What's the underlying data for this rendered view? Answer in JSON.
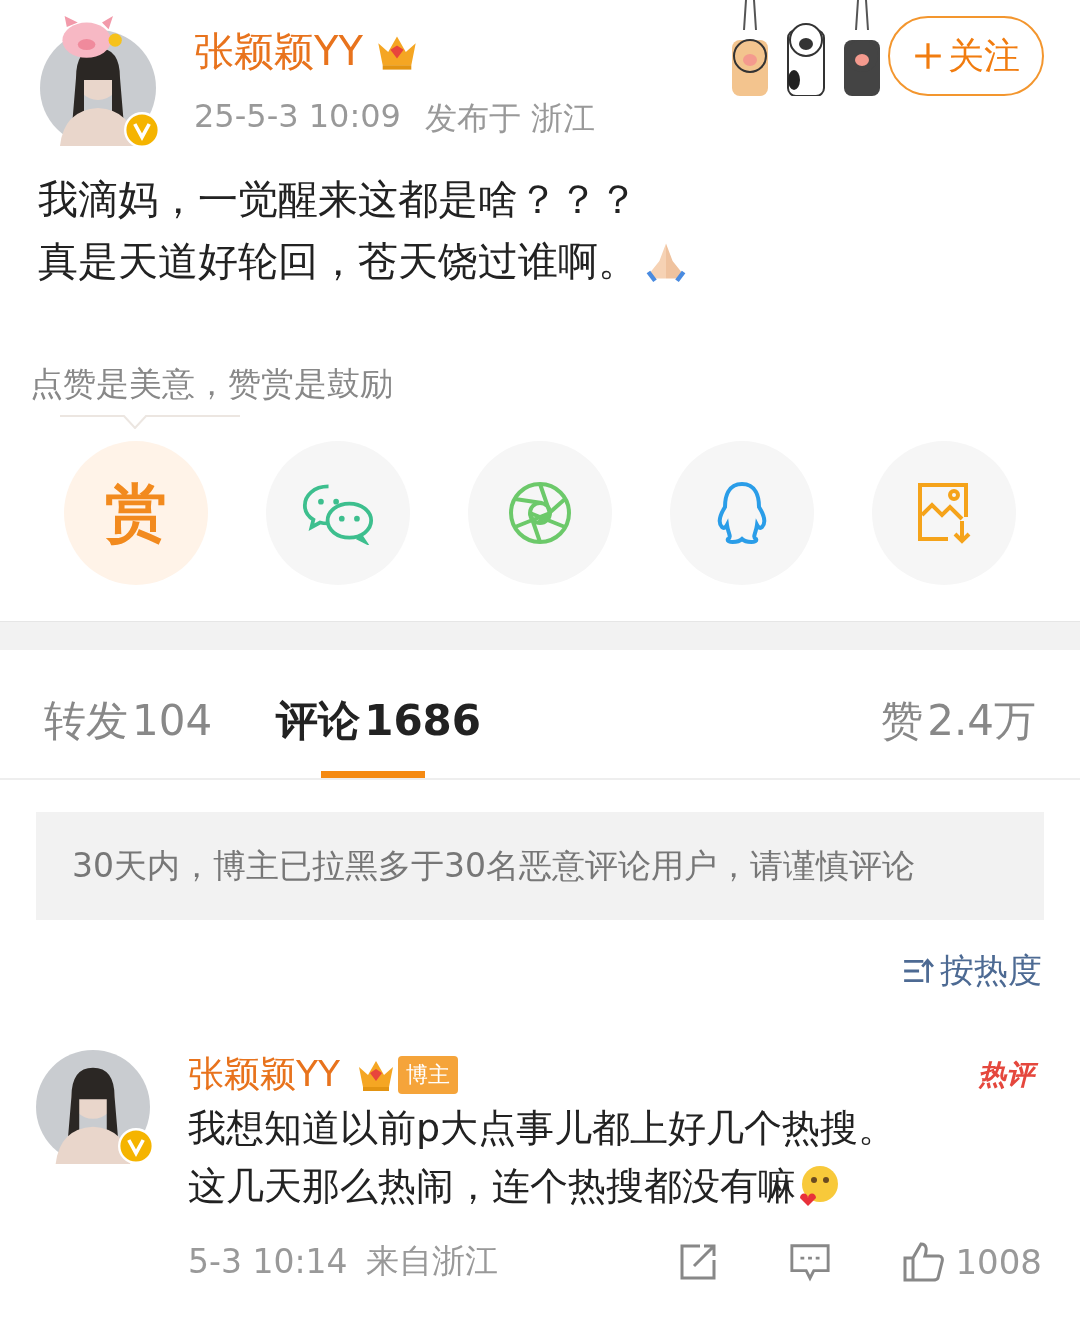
{
  "post": {
    "author": "张颖颖YY",
    "verified": true,
    "time": "25-5-3 10:09",
    "location": "发布于 浙江",
    "follow_button": "关注",
    "lines": [
      "我滴妈，一觉醒来这都是啥？？？",
      "真是天道好轮回，苍天饶过谁啊。"
    ]
  },
  "reward_hint": "点赞是美意，赞赏是鼓励",
  "share_actions": [
    {
      "kind": "reward",
      "label": "赏"
    },
    {
      "kind": "wechat"
    },
    {
      "kind": "moments"
    },
    {
      "kind": "qq"
    },
    {
      "kind": "save_image"
    }
  ],
  "tabs": [
    {
      "label": "转发",
      "count": "104",
      "selected": false
    },
    {
      "label": "评论",
      "count": "1686",
      "selected": true
    },
    {
      "label": "赞",
      "count": "2.4万",
      "selected": false
    }
  ],
  "notice": "30天内，博主已拉黑多于30名恶意评论用户，请谨慎评论",
  "sort": "按热度",
  "comments": [
    {
      "name": "张颖颖YY",
      "verified": true,
      "badge": "博主",
      "hot_label": "热评",
      "lines": [
        "我想知道以前p大点事儿都上好几个热搜。",
        "这几天那么热闹，连个热搜都没有嘛"
      ],
      "time": "5-3 10:14",
      "location": "来自浙江",
      "likes": "1008"
    }
  ]
}
